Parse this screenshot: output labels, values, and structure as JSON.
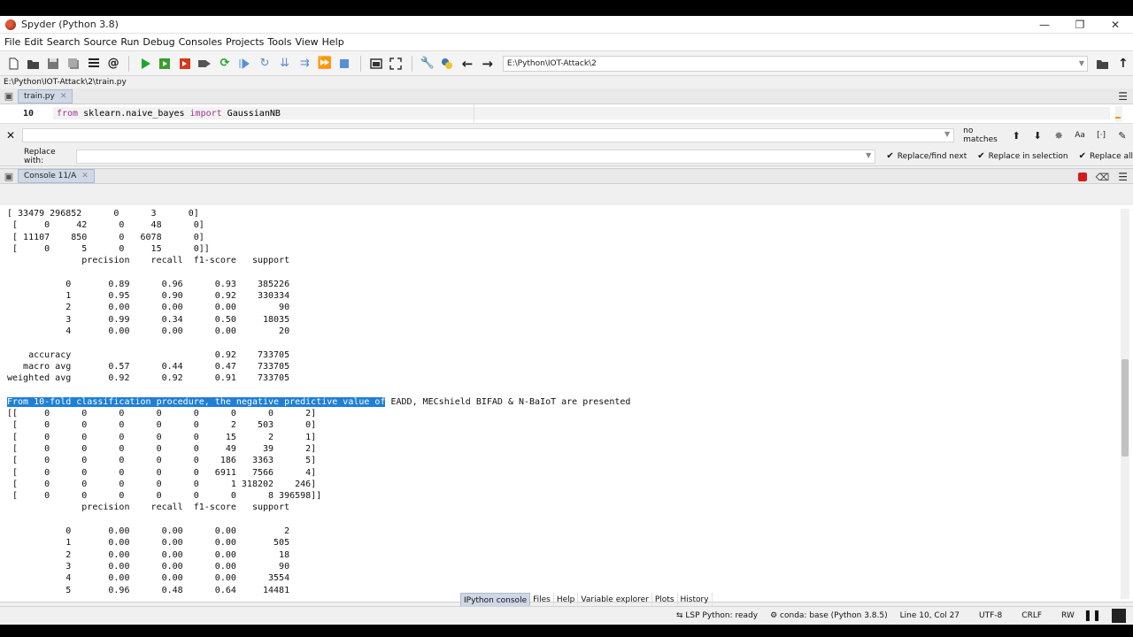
{
  "window": {
    "title": "Spyder (Python 3.8)"
  },
  "menu": [
    "File",
    "Edit",
    "Search",
    "Source",
    "Run",
    "Debug",
    "Consoles",
    "Projects",
    "Tools",
    "View",
    "Help"
  ],
  "toolbar": {
    "path": "E:\\Python\\IOT-Attack\\2"
  },
  "editor": {
    "file_path": "E:\\Python\\IOT-Attack\\2\\train.py",
    "tab_label": "train.py",
    "line_number": "10",
    "code_kw1": "from",
    "code_mod": " sklearn.naive_bayes ",
    "code_kw2": "import",
    "code_name": " GaussianNB"
  },
  "find": {
    "status": "no matches",
    "case_label": "Aa",
    "replace_label": "Replace with:",
    "replace_find_next": "Replace/find next",
    "replace_in_selection": "Replace in selection",
    "replace_all": "Replace all"
  },
  "console": {
    "tab_label": "Console 11/A",
    "block1": "[ 33479 296852      0      3      0]\n [     0     42      0     48      0]\n [ 11107    850      0   6078      0]\n [     0      5      0     15      0]]\n              precision    recall  f1-score   support\n\n           0       0.89      0.96      0.93    385226\n           1       0.95      0.90      0.92    330334\n           2       0.00      0.00      0.00        90\n           3       0.99      0.34      0.50     18035\n           4       0.00      0.00      0.00        20\n\n    accuracy                           0.92    733705\n   macro avg       0.57      0.44      0.47    733705\nweighted avg       0.92      0.92      0.91    733705\n\n",
    "highlight": "From 10-fold classification procedure, the negative predictive value of",
    "highlight_rest": " EADD, MECshield BIFAD & N-BaIoT are presented",
    "block2": "\n[[     0      0      0      0      0      0      0      2]\n [     0      0      0      0      0      2    503      0]\n [     0      0      0      0      0     15      2      1]\n [     0      0      0      0      0     49     39      2]\n [     0      0      0      0      0    186   3363      5]\n [     0      0      0      0      0   6911   7566      4]\n [     0      0      0      0      0      1 318202    246]\n [     0      0      0      0      0      0      8 396598]]\n              precision    recall  f1-score   support\n\n           0       0.00      0.00      0.00         2\n           1       0.00      0.00      0.00       505\n           2       0.00      0.00      0.00        18\n           3       0.00      0.00      0.00        90\n           4       0.00      0.00      0.00      3554\n           5       0.96      0.48      0.64     14481"
  },
  "pane_tabs": [
    "IPython console",
    "Files",
    "Help",
    "Variable explorer",
    "Plots",
    "History"
  ],
  "status": {
    "lsp": "LSP Python: ready",
    "conda": "conda: base (Python 3.8.5)",
    "position": "Line 10, Col 27",
    "encoding": "UTF-8",
    "eol": "CRLF",
    "mode": "RW"
  }
}
